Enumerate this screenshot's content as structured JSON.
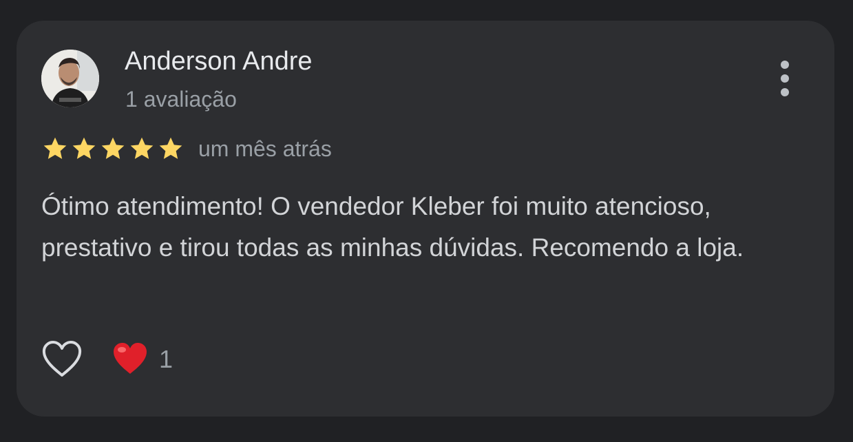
{
  "review": {
    "reviewer_name": "Anderson Andre",
    "review_count": "1 avaliação",
    "rating": 5,
    "max_rating": 5,
    "date": "um mês atrás",
    "text": "Ótimo atendimento! O vendedor Kleber foi muito atencioso, prestativo e tirou todas as minhas dúvidas. Recomendo a loja.",
    "reactions": {
      "count": "1",
      "icon": "red-heart-emoji"
    }
  },
  "icons": {
    "more": "more-vert-icon",
    "like": "heart-outline-icon",
    "star": "star-icon"
  },
  "colors": {
    "background": "#202124",
    "card": "#2d2e31",
    "star": "#fdd663",
    "name": "#e8eaed",
    "secondary": "#9aa0a6",
    "body_text": "#d2d4d7",
    "reaction_heart": "#e0202a"
  }
}
